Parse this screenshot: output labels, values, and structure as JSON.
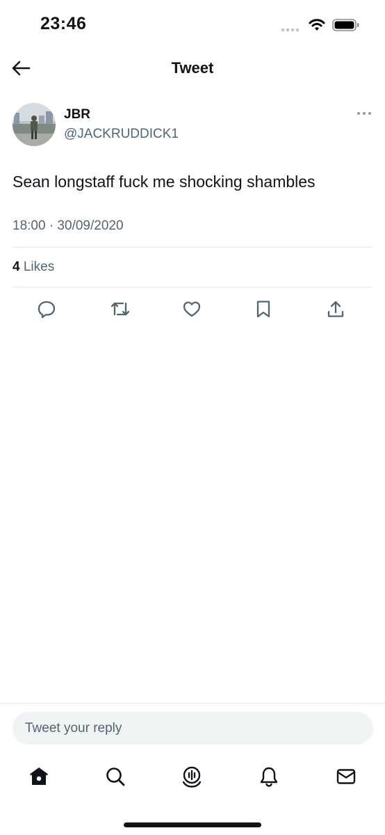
{
  "status_bar": {
    "time": "23:46"
  },
  "header": {
    "title": "Tweet"
  },
  "author": {
    "name": "JBR",
    "handle": "@JACKRUDDICK1"
  },
  "tweet": {
    "text": "Sean longstaff fuck me shocking shambles",
    "timestamp": "18:00 · 30/09/2020",
    "likes_count": "4",
    "likes_label": " Likes"
  },
  "actions": [
    "reply-icon",
    "retweet-icon",
    "like-icon",
    "bookmark-icon",
    "share-icon"
  ],
  "reply": {
    "placeholder": "Tweet your reply"
  },
  "bottom_nav": [
    "home-icon",
    "search-icon",
    "spaces-icon",
    "notifications-icon",
    "messages-icon"
  ],
  "colors": {
    "text": "#0f1419",
    "secondary": "#536471",
    "divider": "#e6e9eb",
    "reply_bg": "#eff3f4"
  }
}
